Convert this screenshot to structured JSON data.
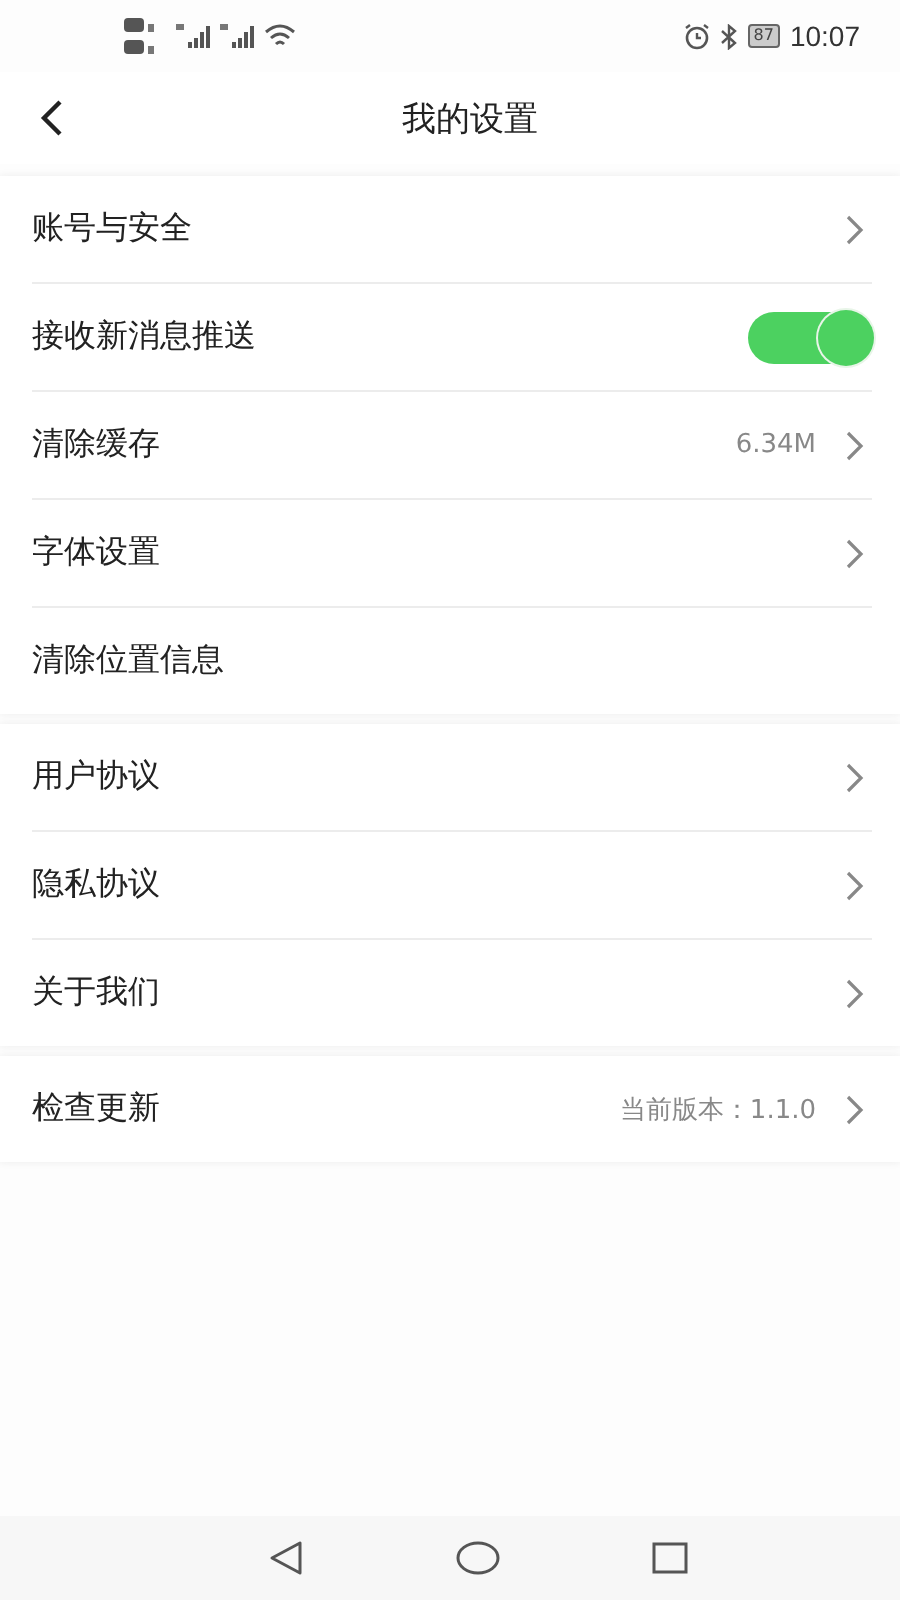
{
  "status_bar": {
    "battery": "87",
    "time": "10:07"
  },
  "header": {
    "title": "我的设置"
  },
  "groups": [
    {
      "items": [
        {
          "kind": "link",
          "label": "账号与安全"
        },
        {
          "kind": "toggle",
          "label": "接收新消息推送",
          "on": true
        },
        {
          "kind": "link",
          "label": "清除缓存",
          "value": "6.34M"
        },
        {
          "kind": "link",
          "label": "字体设置"
        },
        {
          "kind": "plain",
          "label": "清除位置信息"
        }
      ]
    },
    {
      "items": [
        {
          "kind": "link",
          "label": "用户协议"
        },
        {
          "kind": "link",
          "label": "隐私协议"
        },
        {
          "kind": "link",
          "label": "关于我们"
        }
      ]
    },
    {
      "items": [
        {
          "kind": "link",
          "label": "检查更新",
          "value": "当前版本：1.1.0"
        }
      ]
    }
  ]
}
